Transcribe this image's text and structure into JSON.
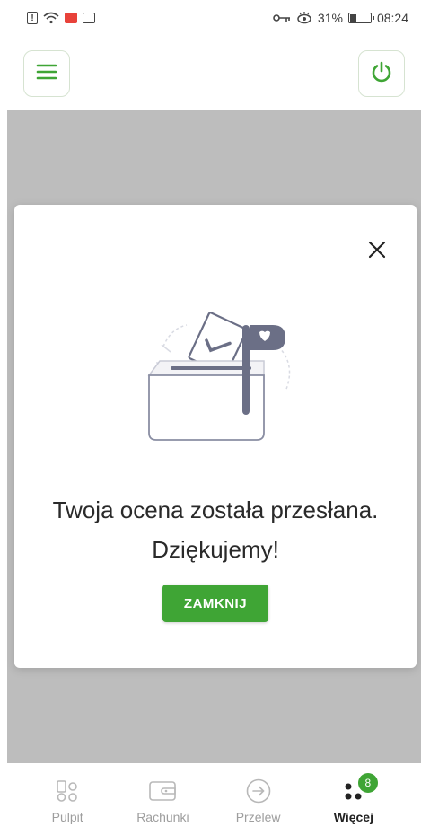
{
  "status_bar": {
    "battery": "31%",
    "time": "08:24"
  },
  "top_bar": {
    "icons": [
      "hamburger-menu-icon",
      "power-icon"
    ]
  },
  "modal": {
    "message_line1": "Twoja ocena została przesłana.",
    "message_line2": "Dziękujemy!",
    "button_label": "ZAMKNIJ",
    "illustration": "ballot-box-illustration"
  },
  "bottom_nav": {
    "items": [
      {
        "label": "Pulpit",
        "icon": "dashboard-icon"
      },
      {
        "label": "Rachunki",
        "icon": "wallet-icon"
      },
      {
        "label": "Przelew",
        "icon": "arrow-circle-icon"
      },
      {
        "label": "Więcej",
        "icon": "more-dots-icon",
        "badge": "8",
        "active": true
      }
    ]
  },
  "colors": {
    "accent": "#3fa535",
    "overlay": "#bdbdbd"
  }
}
